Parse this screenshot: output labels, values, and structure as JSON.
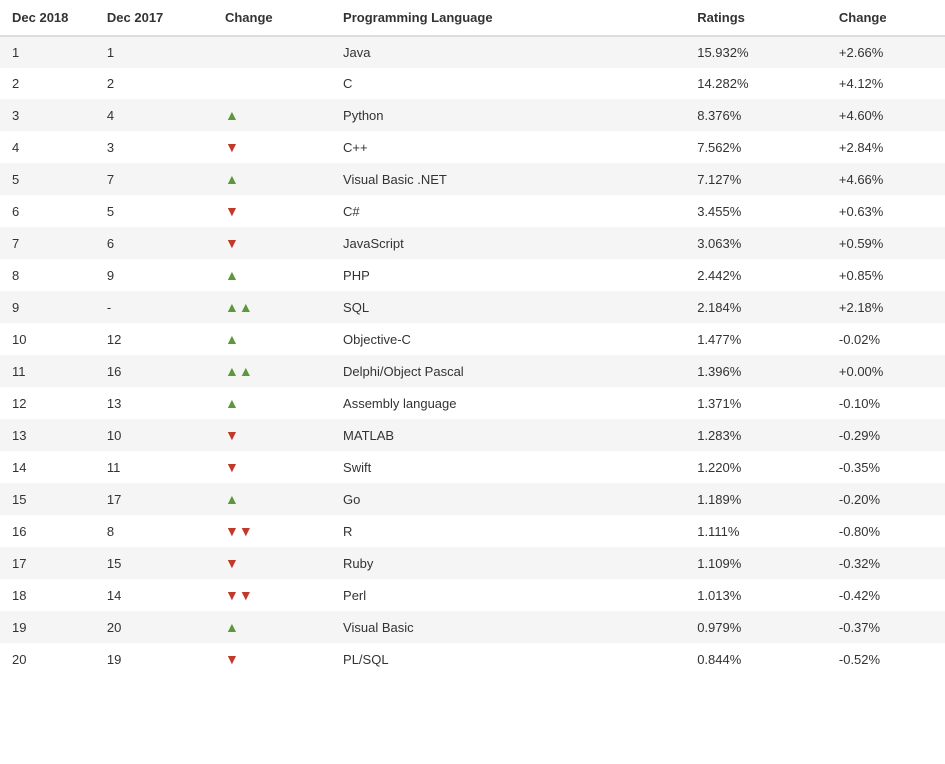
{
  "table": {
    "headers": {
      "dec2018": "Dec 2018",
      "dec2017": "Dec 2017",
      "change": "Change",
      "language": "Programming Language",
      "ratings": "Ratings",
      "change2": "Change"
    },
    "rows": [
      {
        "dec2018": "1",
        "dec2017": "1",
        "arrow": "none",
        "language": "Java",
        "ratings": "15.932%",
        "change": "+2.66%"
      },
      {
        "dec2018": "2",
        "dec2017": "2",
        "arrow": "none",
        "language": "C",
        "ratings": "14.282%",
        "change": "+4.12%"
      },
      {
        "dec2018": "3",
        "dec2017": "4",
        "arrow": "up",
        "language": "Python",
        "ratings": "8.376%",
        "change": "+4.60%"
      },
      {
        "dec2018": "4",
        "dec2017": "3",
        "arrow": "down",
        "language": "C++",
        "ratings": "7.562%",
        "change": "+2.84%"
      },
      {
        "dec2018": "5",
        "dec2017": "7",
        "arrow": "up",
        "language": "Visual Basic .NET",
        "ratings": "7.127%",
        "change": "+4.66%"
      },
      {
        "dec2018": "6",
        "dec2017": "5",
        "arrow": "down",
        "language": "C#",
        "ratings": "3.455%",
        "change": "+0.63%"
      },
      {
        "dec2018": "7",
        "dec2017": "6",
        "arrow": "down",
        "language": "JavaScript",
        "ratings": "3.063%",
        "change": "+0.59%"
      },
      {
        "dec2018": "8",
        "dec2017": "9",
        "arrow": "up",
        "language": "PHP",
        "ratings": "2.442%",
        "change": "+0.85%"
      },
      {
        "dec2018": "9",
        "dec2017": "-",
        "arrow": "double-up",
        "language": "SQL",
        "ratings": "2.184%",
        "change": "+2.18%"
      },
      {
        "dec2018": "10",
        "dec2017": "12",
        "arrow": "up",
        "language": "Objective-C",
        "ratings": "1.477%",
        "change": "-0.02%"
      },
      {
        "dec2018": "11",
        "dec2017": "16",
        "arrow": "double-up",
        "language": "Delphi/Object Pascal",
        "ratings": "1.396%",
        "change": "+0.00%"
      },
      {
        "dec2018": "12",
        "dec2017": "13",
        "arrow": "up",
        "language": "Assembly language",
        "ratings": "1.371%",
        "change": "-0.10%"
      },
      {
        "dec2018": "13",
        "dec2017": "10",
        "arrow": "down",
        "language": "MATLAB",
        "ratings": "1.283%",
        "change": "-0.29%"
      },
      {
        "dec2018": "14",
        "dec2017": "11",
        "arrow": "down",
        "language": "Swift",
        "ratings": "1.220%",
        "change": "-0.35%"
      },
      {
        "dec2018": "15",
        "dec2017": "17",
        "arrow": "up",
        "language": "Go",
        "ratings": "1.189%",
        "change": "-0.20%"
      },
      {
        "dec2018": "16",
        "dec2017": "8",
        "arrow": "double-down",
        "language": "R",
        "ratings": "1.111%",
        "change": "-0.80%"
      },
      {
        "dec2018": "17",
        "dec2017": "15",
        "arrow": "down",
        "language": "Ruby",
        "ratings": "1.109%",
        "change": "-0.32%"
      },
      {
        "dec2018": "18",
        "dec2017": "14",
        "arrow": "double-down",
        "language": "Perl",
        "ratings": "1.013%",
        "change": "-0.42%"
      },
      {
        "dec2018": "19",
        "dec2017": "20",
        "arrow": "up",
        "language": "Visual Basic",
        "ratings": "0.979%",
        "change": "-0.37%"
      },
      {
        "dec2018": "20",
        "dec2017": "19",
        "arrow": "down",
        "language": "PL/SQL",
        "ratings": "0.844%",
        "change": "-0.52%"
      }
    ]
  }
}
